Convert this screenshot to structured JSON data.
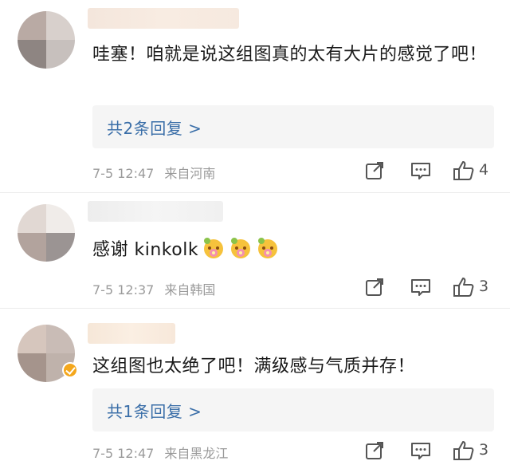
{
  "comments": [
    {
      "text": "哇塞！咱就是说这组图真的太有大片的感觉了吧！",
      "reply_link": "共2条回复 >",
      "time": "7-5 12:47",
      "location": "来自河南",
      "likes": "4"
    },
    {
      "text": "感谢 kinkolk",
      "emoji": "flower-face-emoji",
      "time": "7-5 12:37",
      "location": "来自韩国",
      "likes": "3"
    },
    {
      "text": "这组图也太绝了吧！满级感与气质并存！",
      "reply_link": "共1条回复 >",
      "time": "7-5 12:47",
      "location": "来自黑龙江",
      "likes": "3",
      "verified_badge": "orange-verified-badge"
    }
  ],
  "icons": {
    "share": "share-icon",
    "comment": "comment-icon",
    "like": "thumbs-up-icon"
  },
  "colors": {
    "reply_link": "#3a6ea8",
    "meta": "#9a9a9a",
    "reply_box": "#f5f5f5",
    "verified": "#f4a71c"
  }
}
